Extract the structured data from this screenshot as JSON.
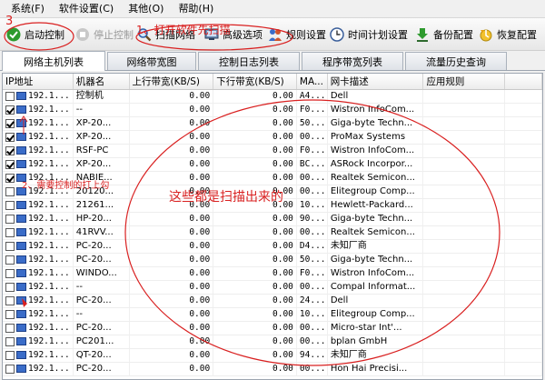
{
  "menu": [
    "系统(F)",
    "软件设置(C)",
    "其他(O)",
    "帮助(H)"
  ],
  "toolbar": {
    "start": "启动控制",
    "stop": "停止控制",
    "scan": "扫描网络",
    "advanced": "高级选项",
    "rules": "规则设置",
    "schedule": "时间计划设置",
    "backup": "备份配置",
    "restore": "恢复配置"
  },
  "tabs": [
    "网络主机列表",
    "网络带宽图",
    "控制日志列表",
    "程序带宽列表",
    "流量历史查询"
  ],
  "columns": [
    "IP地址",
    "机器名",
    "上行带宽(KB/S)",
    "下行带宽(KB/S)",
    "MA...",
    "网卡描述",
    "应用规则"
  ],
  "rows": [
    {
      "checked": false,
      "ip": "192.1...",
      "name": "控制机",
      "up": "0.00",
      "down": "0.00",
      "mac": "A4...",
      "nic": "Dell",
      "rule": ""
    },
    {
      "checked": true,
      "ip": "192.1...",
      "name": "--",
      "up": "0.00",
      "down": "0.00",
      "mac": "F0...",
      "nic": "Wistron InfoCom...",
      "rule": ""
    },
    {
      "checked": true,
      "ip": "192.1...",
      "name": "XP-20...",
      "up": "0.00",
      "down": "0.00",
      "mac": "50...",
      "nic": "Giga-byte Techn...",
      "rule": ""
    },
    {
      "checked": true,
      "ip": "192.1...",
      "name": "XP-20...",
      "up": "0.00",
      "down": "0.00",
      "mac": "00...",
      "nic": "ProMax Systems",
      "rule": ""
    },
    {
      "checked": true,
      "ip": "192.1...",
      "name": "RSF-PC",
      "up": "0.00",
      "down": "0.00",
      "mac": "F0...",
      "nic": "Wistron InfoCom...",
      "rule": ""
    },
    {
      "checked": true,
      "ip": "192.1...",
      "name": "XP-20...",
      "up": "0.00",
      "down": "0.00",
      "mac": "BC...",
      "nic": "ASRock Incorpor...",
      "rule": ""
    },
    {
      "checked": true,
      "ip": "192.1...",
      "name": "NABIE...",
      "up": "0.00",
      "down": "0.00",
      "mac": "00...",
      "nic": "Realtek Semicon...",
      "rule": ""
    },
    {
      "checked": false,
      "ip": "192.1...",
      "name": "20120...",
      "up": "0.00",
      "down": "0.00",
      "mac": "00...",
      "nic": "Elitegroup Comp...",
      "rule": ""
    },
    {
      "checked": false,
      "ip": "192.1...",
      "name": "21261...",
      "up": "0.00",
      "down": "0.00",
      "mac": "10...",
      "nic": "Hewlett-Packard...",
      "rule": ""
    },
    {
      "checked": false,
      "ip": "192.1...",
      "name": "HP-20...",
      "up": "0.00",
      "down": "0.00",
      "mac": "90...",
      "nic": "Giga-byte Techn...",
      "rule": ""
    },
    {
      "checked": false,
      "ip": "192.1...",
      "name": "41RVV...",
      "up": "0.00",
      "down": "0.00",
      "mac": "00...",
      "nic": "Realtek Semicon...",
      "rule": ""
    },
    {
      "checked": false,
      "ip": "192.1...",
      "name": "PC-20...",
      "up": "0.00",
      "down": "0.00",
      "mac": "D4...",
      "nic": "未知厂商",
      "rule": ""
    },
    {
      "checked": false,
      "ip": "192.1...",
      "name": "PC-20...",
      "up": "0.00",
      "down": "0.00",
      "mac": "50...",
      "nic": "Giga-byte Techn...",
      "rule": ""
    },
    {
      "checked": false,
      "ip": "192.1...",
      "name": "WINDO...",
      "up": "0.00",
      "down": "0.00",
      "mac": "F0...",
      "nic": "Wistron InfoCom...",
      "rule": ""
    },
    {
      "checked": false,
      "ip": "192.1...",
      "name": "--",
      "up": "0.00",
      "down": "0.00",
      "mac": "00...",
      "nic": "Compal Informat...",
      "rule": ""
    },
    {
      "checked": false,
      "ip": "192.1...",
      "name": "PC-20...",
      "up": "0.00",
      "down": "0.00",
      "mac": "24...",
      "nic": "Dell",
      "rule": ""
    },
    {
      "checked": false,
      "ip": "192.1...",
      "name": "--",
      "up": "0.00",
      "down": "0.00",
      "mac": "10...",
      "nic": "Elitegroup Comp...",
      "rule": ""
    },
    {
      "checked": false,
      "ip": "192.1...",
      "name": "PC-20...",
      "up": "0.00",
      "down": "0.00",
      "mac": "00...",
      "nic": "Micro-star Int'...",
      "rule": ""
    },
    {
      "checked": false,
      "ip": "192.1...",
      "name": "PC201...",
      "up": "0.00",
      "down": "0.00",
      "mac": "00...",
      "nic": "bplan GmbH",
      "rule": ""
    },
    {
      "checked": false,
      "ip": "192.1...",
      "name": "QT-20...",
      "up": "0.00",
      "down": "0.00",
      "mac": "94...",
      "nic": "未知厂商",
      "rule": ""
    },
    {
      "checked": false,
      "ip": "192.1...",
      "name": "PC-20...",
      "up": "0.00",
      "down": "0.00",
      "mac": "00...",
      "nic": "Hon Hai Precisi...",
      "rule": ""
    }
  ],
  "annotations": {
    "step1": "1、打开软件先扫描",
    "step2": "2、需要控制的打上勾",
    "step3": "3",
    "scanned": "这些都是扫描出来的"
  },
  "colors": {
    "annotation": "#d92020",
    "accent": "#3a6cc8"
  }
}
